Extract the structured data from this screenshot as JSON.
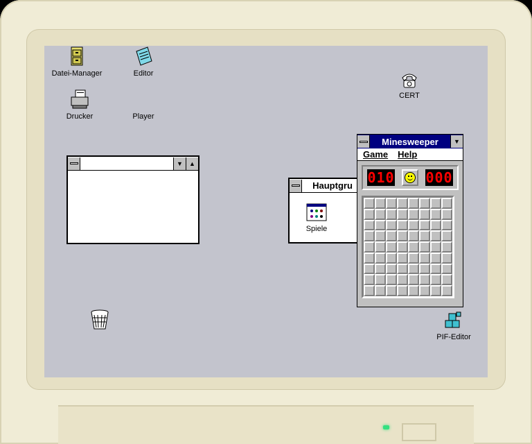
{
  "desktop": {
    "icons": [
      {
        "label": "Datei-Manager",
        "icon": "file-cabinet-icon"
      },
      {
        "label": "Editor",
        "icon": "notepad-icon"
      },
      {
        "label": "Drucker",
        "icon": "printer-icon"
      },
      {
        "label": "Player",
        "icon": ""
      },
      {
        "label": "CERT",
        "icon": "telephone-icon"
      },
      {
        "label": "PIF-Editor",
        "icon": "cubes-icon"
      }
    ],
    "trash_icon": "wastebasket-icon"
  },
  "blank_window": {
    "title": ""
  },
  "hauptgruppe": {
    "title": "Hauptgru",
    "items": [
      {
        "label": "Spiele",
        "icon": "program-group-icon"
      }
    ]
  },
  "minesweeper": {
    "title": "Minesweeper",
    "menu": [
      "Game",
      "Help"
    ],
    "mines_counter": "010",
    "timer": "000",
    "face": "smiley",
    "rows": 9,
    "cols": 8
  },
  "colors": {
    "desktop": "#c3c4cd",
    "titlebar": "#000080",
    "lcd": "#ff0000"
  }
}
